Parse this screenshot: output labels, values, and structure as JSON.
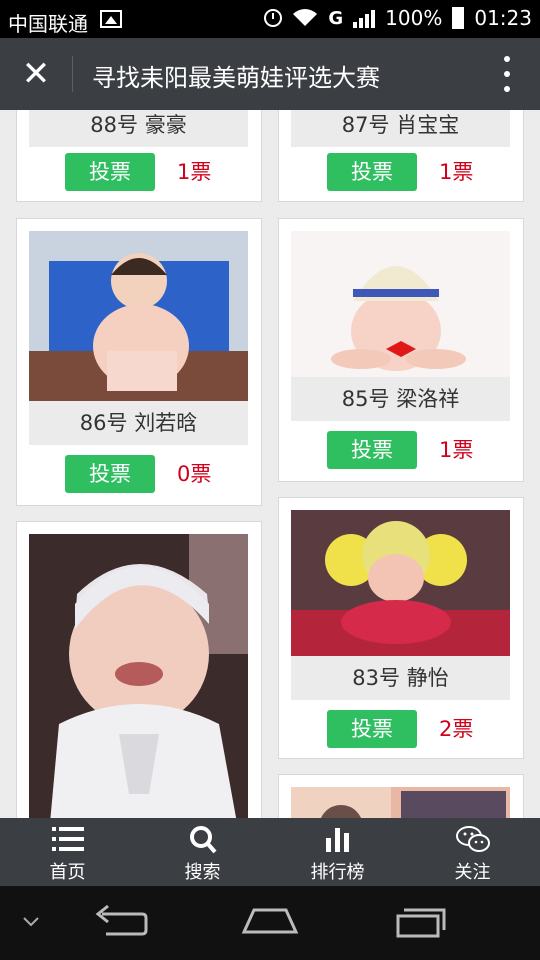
{
  "status_bar": {
    "carrier": "中国联通",
    "network": "G",
    "battery": "100%",
    "time": "01:23"
  },
  "title_bar": {
    "title": "寻找耒阳最美萌娃评选大赛",
    "close_icon": "close-icon",
    "more_icon": "more-vertical-icon"
  },
  "cards": [
    {
      "name": "88号 豪豪",
      "vote_label": "投票",
      "votes": "1票"
    },
    {
      "name": "87号 肖宝宝",
      "vote_label": "投票",
      "votes": "1票"
    },
    {
      "name": "86号 刘若晗",
      "vote_label": "投票",
      "votes": "0票"
    },
    {
      "name": "85号 梁洛祥",
      "vote_label": "投票",
      "votes": "1票"
    },
    {
      "name": "83号 静怡",
      "vote_label": "投票",
      "votes": "2票"
    }
  ],
  "bottom_nav": [
    {
      "label": "首页",
      "icon": "list-icon"
    },
    {
      "label": "搜索",
      "icon": "search-icon"
    },
    {
      "label": "排行榜",
      "icon": "bar-chart-icon"
    },
    {
      "label": "关注",
      "icon": "wechat-icon"
    }
  ],
  "colors": {
    "vote_button": "#2fbf61",
    "vote_count": "#d0021b",
    "bar_background": "#3b3e43"
  }
}
